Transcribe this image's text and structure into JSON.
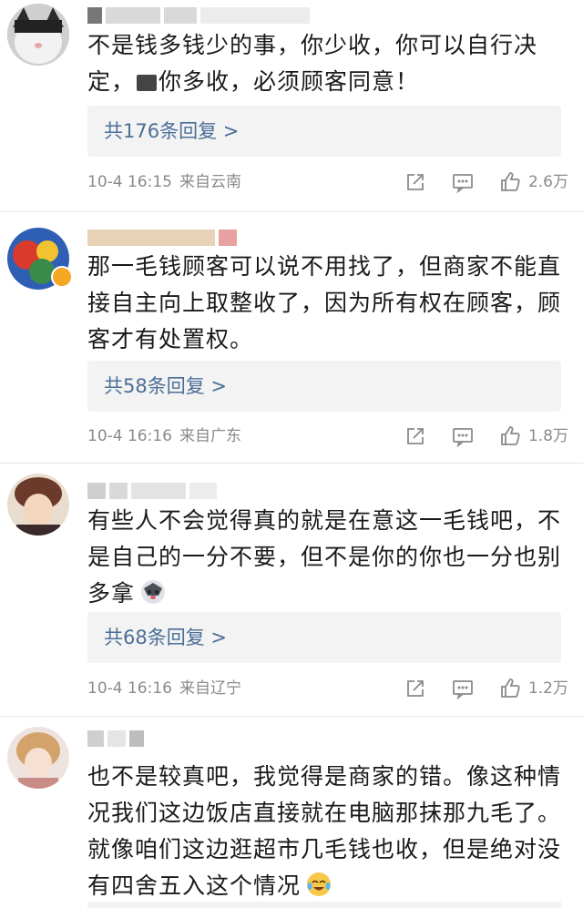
{
  "comments": [
    {
      "text_before_mask": "不是钱多钱少的事，你少收，你可以自行决定，",
      "text_after_mask": "你多收，必须顾客同意！",
      "reply_label": "共176条回复 >",
      "time": "10-4 16:15",
      "location": "来自云南",
      "likes": "2.6万"
    },
    {
      "text": "那一毛钱顾客可以说不用找了，但商家不能直接自主向上取整收了，因为所有权在顾客，顾客才有处置权。",
      "reply_label": "共58条回复 >",
      "time": "10-4 16:16",
      "location": "来自广东",
      "likes": "1.8万"
    },
    {
      "text": "有些人不会觉得真的就是在意这一毛钱吧，不是自己的一分不要，但不是你的你也一分也别多拿",
      "reply_label": "共68条回复 >",
      "time": "10-4 16:16",
      "location": "来自辽宁",
      "likes": "1.2万"
    },
    {
      "text": "也不是较真吧，我觉得是商家的错。像这种情况我们这边饭店直接就在电脑那抹那九毛了。就像咱们这边逛超市几毛钱也收，但是绝对没有四舍五入这个情况"
    }
  ],
  "icons": [
    "share-icon",
    "comment-icon",
    "like-icon"
  ]
}
